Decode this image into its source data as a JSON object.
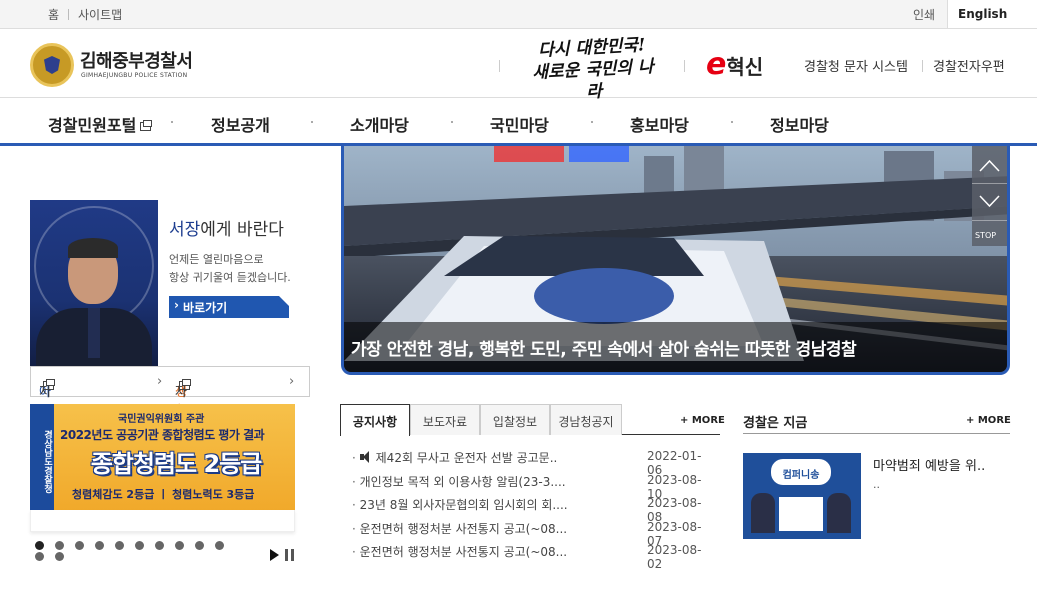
{
  "topbar": {
    "home": "홈",
    "sitemap": "사이트맵",
    "print": "인쇄",
    "english": "English"
  },
  "header": {
    "title": "김해중부경찰서",
    "subtitle": "GIMHAEJUNGBU POLICE STATION",
    "slogan_line1": "다시 대한민국!",
    "slogan_line2": "새로운 국민의 나라",
    "einno": "혁신",
    "einno_e": "e",
    "link_sms": "경찰청 문자 시스템",
    "link_mail": "경찰전자우편"
  },
  "gnb": {
    "items": [
      "경찰민원포털",
      "정보공개",
      "소개마당",
      "국민마당",
      "홍보마당",
      "정보마당"
    ]
  },
  "chief": {
    "title_strong": "서장",
    "title_rest": "에게 바란다",
    "text_line1": "언제든 열린마음으로",
    "text_line2": "항상 귀기울여 듣겠습니다.",
    "button": "바로가기"
  },
  "quick": {
    "a_strong": "아동안전",
    "a_rest": "지킴이",
    "b_strong": "생활치안",
    "b_rest": "자료실",
    "arrow": "›"
  },
  "banner": {
    "vtab": "경상남도경찰청",
    "line1": "국민권익위원회 주관",
    "line2": "2022년도 공공기관 종합청렴도 평가 결과",
    "line3": "종합청렴도 2등급",
    "line4": "청렴체감도 2등급 ㅣ 청렴노력도 3등급",
    "slide_count": 12,
    "active_slide": 1
  },
  "hero": {
    "caption": "가장 안전한 경남, 행복한 도민, 주민 속에서 살아 숨쉬는 따뜻한 경남경찰",
    "stop": "STOP"
  },
  "notice": {
    "tabs": [
      "공지사항",
      "보도자료",
      "입찰정보",
      "경남청공지"
    ],
    "more": "+ MORE",
    "rows": [
      {
        "title": "제42회 무사고 운전자 선발 공고문..",
        "date": "2022-01-06",
        "speaker": true
      },
      {
        "title": "개인정보 목적 외 이용사항 알림(23-3....",
        "date": "2023-08-10"
      },
      {
        "title": "23년 8월 외사자문협의회 임시회의 회....",
        "date": "2023-08-08"
      },
      {
        "title": "운전면허 행정처분 사전통지 공고(~08....",
        "date": "2023-08-07"
      },
      {
        "title": "운전면허 행정처분 사전통지 공고(~08....",
        "date": "2023-08-02"
      }
    ]
  },
  "now": {
    "title": "경찰은 지금",
    "more": "+ MORE",
    "item_title": "마약범죄 예방을 위..",
    "item_sub": "..",
    "thumb_text": "컴퍼니송"
  },
  "colors": {
    "accent": "#2a5bb5",
    "button": "#2057b0",
    "orange": "#e8732a",
    "einno_red": "#e60012"
  }
}
